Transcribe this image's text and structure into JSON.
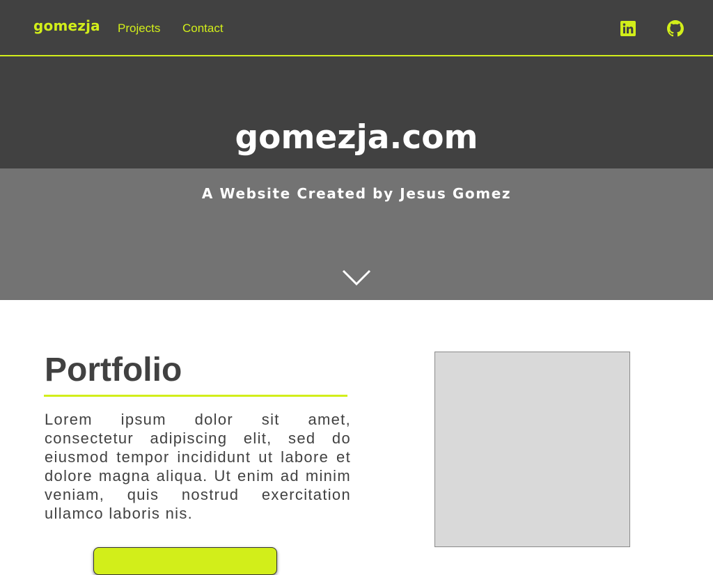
{
  "nav": {
    "brand": "gomezja",
    "links": [
      {
        "label": "Projects"
      },
      {
        "label": "Contact"
      }
    ],
    "social": [
      {
        "icon": "linkedin-icon"
      },
      {
        "icon": "github-icon"
      }
    ]
  },
  "hero": {
    "title": "gomezja.com",
    "subtitle": "A Website Created by Jesus Gomez",
    "scroll_icon": "chevron-down-icon"
  },
  "portfolio": {
    "heading": "Portfolio",
    "body": "Lorem ipsum dolor sit amet, consectetur adipiscing elit, sed do eiusmod tempor incididunt ut labore et dolore magna aliqua. Ut enim ad minim veniam, quis nostrud exercitation ullamco laboris nis.",
    "image": "image-placeholder",
    "button_label": ""
  },
  "colors": {
    "accent": "#d2ee1a",
    "dark": "#414141",
    "hero_lower": "#737373",
    "placeholder": "#d9d9d9",
    "text": "#414141"
  }
}
